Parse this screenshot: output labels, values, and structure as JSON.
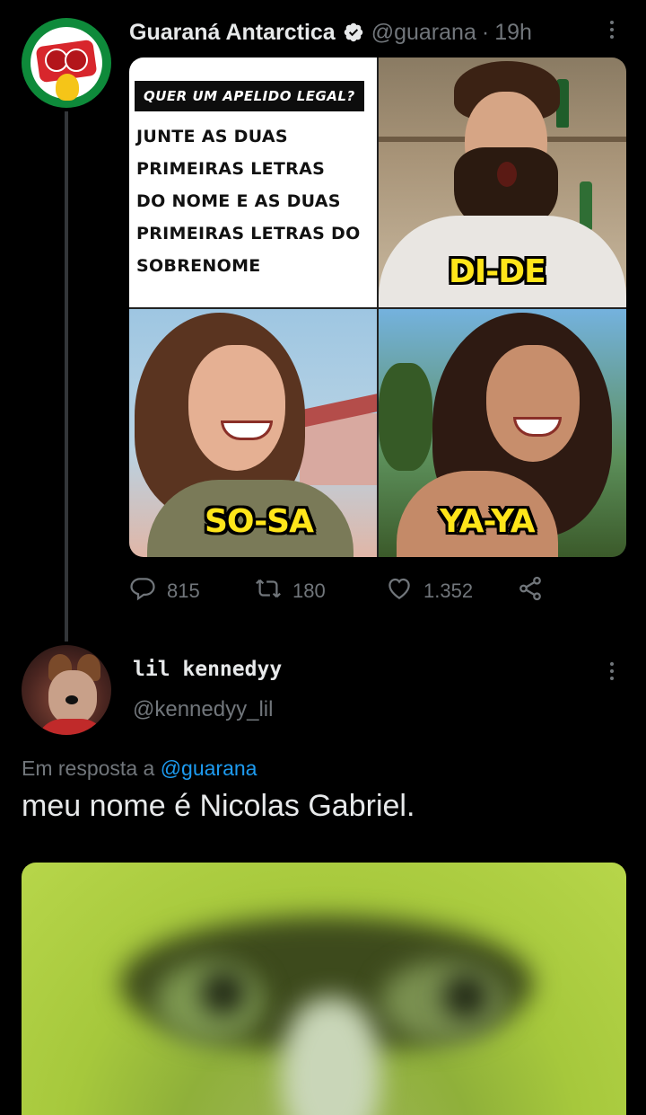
{
  "tweet1": {
    "author_name": "Guaraná Antarctica",
    "author_handle": "@guarana",
    "separator": "·",
    "time": "19h",
    "meme": {
      "banner": "QUER UM APELIDO LEGAL?",
      "body_lines": [
        "JUNTE AS DUAS",
        "PRIMEIRAS LETRAS",
        "DO NOME E AS DUAS",
        "PRIMEIRAS LETRAS  DO",
        "SOBRENOME"
      ],
      "captions": [
        "DI-DE",
        "SO-SA",
        "YA-YA"
      ]
    },
    "actions": {
      "replies": "815",
      "retweets": "180",
      "likes": "1.352"
    }
  },
  "tweet2": {
    "author_name": "lil kennedyy",
    "author_handle": "@kennedyy_lil",
    "reply_prefix": "Em resposta a",
    "reply_mention": "@guarana",
    "text": "meu nome é Nicolas Gabriel."
  },
  "icons": {
    "verified": "verified-badge-icon",
    "more": "more-icon",
    "reply": "reply-icon",
    "retweet": "retweet-icon",
    "like": "heart-icon",
    "share": "share-icon"
  },
  "colors": {
    "background": "#000000",
    "text_primary": "#e7e9ea",
    "text_secondary": "#71767b",
    "link": "#1d9bf0",
    "caption_yellow": "#ffe51a"
  }
}
